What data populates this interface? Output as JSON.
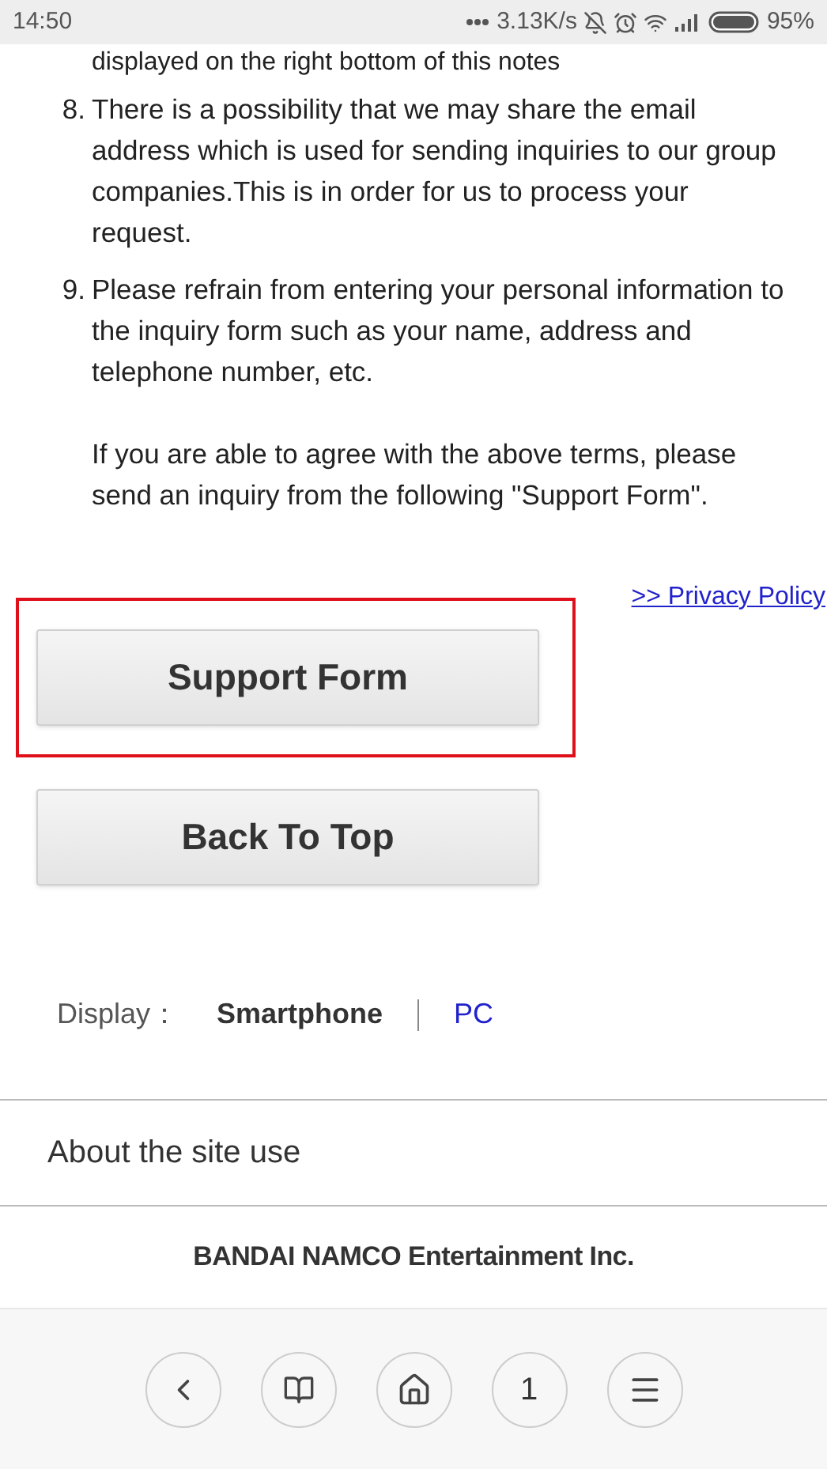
{
  "status_bar": {
    "time": "14:50",
    "speed": "3.13K/s",
    "battery": "95%"
  },
  "notes_cut_line": "displayed on the right bottom of this notes",
  "notes": [
    {
      "number": "8.",
      "paragraphs": [
        "There is a possibility that we may share the email address which is used for sending inquiries to our group companies.This is in order for us to process your request."
      ]
    },
    {
      "number": "9.",
      "paragraphs": [
        "Please refrain from entering your personal information to the inquiry form such as your name, address and telephone number, etc.",
        "If you are able to agree with the above terms, please send an inquiry from the following \"Support Form\"."
      ]
    }
  ],
  "privacy_link": ">> Privacy Policy",
  "buttons": [
    {
      "label": "Support Form",
      "highlighted": true
    },
    {
      "label": "Back To Top",
      "highlighted": false
    }
  ],
  "display": {
    "label": "Display：",
    "options": [
      {
        "label": "Smartphone",
        "selected": true
      },
      {
        "label": "PC",
        "selected": false
      }
    ]
  },
  "footer_link": "About the site use",
  "company": "BANDAI NAMCO Entertainment Inc.",
  "browser_bar": {
    "tab_count": "1"
  }
}
